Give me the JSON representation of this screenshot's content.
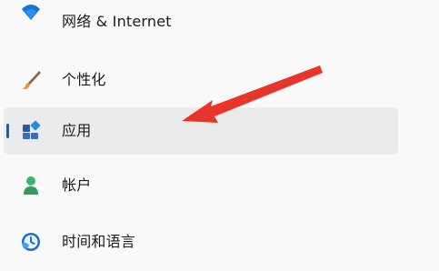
{
  "nav": {
    "items": [
      {
        "label": "网络 & Internet",
        "icon": "wifi-icon"
      },
      {
        "label": "个性化",
        "icon": "brush-icon"
      },
      {
        "label": "应用",
        "icon": "apps-icon",
        "selected": true
      },
      {
        "label": "帐户",
        "icon": "person-icon"
      },
      {
        "label": "时间和语言",
        "icon": "globe-clock-icon"
      }
    ]
  },
  "colors": {
    "accent": "#0067c0",
    "selected_background": "#ebebeb",
    "arrow": "#e8352b"
  }
}
